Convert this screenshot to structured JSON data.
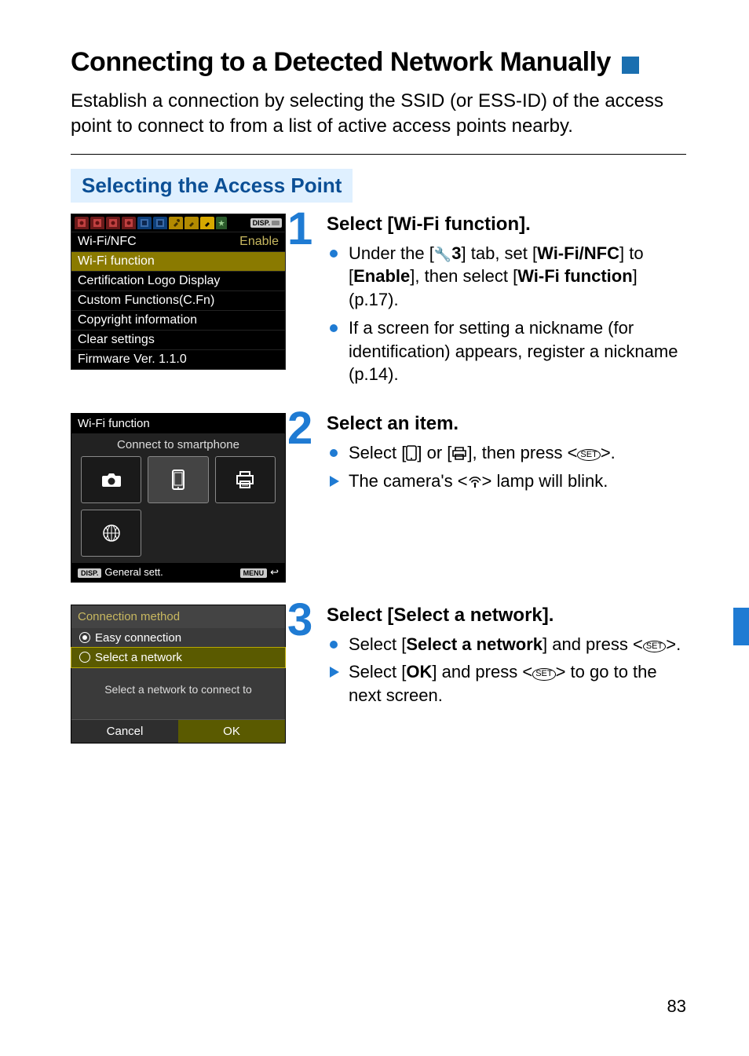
{
  "page": {
    "title": "Connecting to a Detected Network Manually",
    "intro": "Establish a connection by selecting the SSID (or ESS-ID) of the access point to connect to from a list of active access points nearby.",
    "subhead": "Selecting the Access Point",
    "number": "83"
  },
  "screen1": {
    "disp_label": "DISP.",
    "rows": [
      {
        "label": "Wi-Fi/NFC",
        "value": "Enable"
      },
      {
        "label": "Wi-Fi function",
        "value": ""
      },
      {
        "label": "Certification Logo Display",
        "value": ""
      },
      {
        "label": "Custom Functions(C.Fn)",
        "value": ""
      },
      {
        "label": "Copyright information",
        "value": ""
      },
      {
        "label": "Clear settings",
        "value": ""
      },
      {
        "label": "Firmware Ver. 1.1.0",
        "value": ""
      }
    ]
  },
  "screen2": {
    "title": "Wi-Fi function",
    "subtitle": "Connect to smartphone",
    "foot_left_badge": "DISP.",
    "foot_left": "General sett.",
    "foot_right_badge": "MENU",
    "foot_right_icon": "↩"
  },
  "screen3": {
    "title": "Connection method",
    "opt1": "Easy connection",
    "opt2": "Select a network",
    "message": "Select a network to connect to",
    "cancel": "Cancel",
    "ok": "OK"
  },
  "step1": {
    "num": "1",
    "title": "Select [Wi-Fi function].",
    "b1a": "Under the [",
    "b1_tab": "3",
    "b1b": "] tab, set [",
    "b1_bold1": "Wi-Fi/NFC",
    "b1c": "] to [",
    "b1_bold2": "Enable",
    "b1d": "], then select [",
    "b1_bold3": "Wi-Fi function",
    "b1e": "] (p.17).",
    "b2": "If a screen for setting a nickname (for identification) appears, register a nickname (p.14)."
  },
  "step2": {
    "num": "2",
    "title": "Select an item.",
    "b1a": "Select [",
    "b1b": "] or [",
    "b1c": "], then press <",
    "b1d": ">.",
    "b2a": "The camera's <",
    "b2b": "> lamp will blink."
  },
  "step3": {
    "num": "3",
    "title": "Select [Select a network].",
    "b1a": "Select [",
    "b1_bold": "Select a network",
    "b1b": "] and press <",
    "b1c": ">.",
    "b2a": "Select [",
    "b2_bold": "OK",
    "b2b": "] and press <",
    "b2c": "> to go to the next screen."
  }
}
